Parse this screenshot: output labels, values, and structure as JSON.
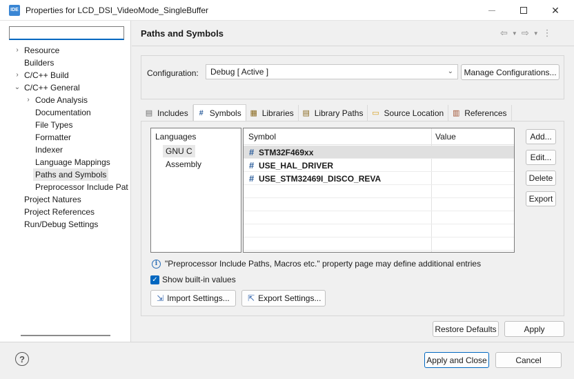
{
  "window": {
    "app_icon": "IDE",
    "title": "Properties for LCD_DSI_VideoMode_SingleBuffer",
    "minimize_icon": "minimize-icon",
    "maximize_icon": "maximize-icon",
    "close_glyph": "✕"
  },
  "sidebar": {
    "filter_value": "",
    "items": [
      {
        "label": "Resource",
        "expander": "›"
      },
      {
        "label": "Builders"
      },
      {
        "label": "C/C++ Build",
        "expander": "›"
      },
      {
        "label": "C/C++ General",
        "expander": "⌄"
      },
      {
        "label": "Code Analysis",
        "expander": "›"
      },
      {
        "label": "Documentation"
      },
      {
        "label": "File Types"
      },
      {
        "label": "Formatter"
      },
      {
        "label": "Indexer"
      },
      {
        "label": "Language Mappings"
      },
      {
        "label": "Paths and Symbols"
      },
      {
        "label": "Preprocessor Include Pat"
      },
      {
        "label": "Project Natures"
      },
      {
        "label": "Project References"
      },
      {
        "label": "Run/Debug Settings"
      }
    ]
  },
  "page": {
    "title": "Paths and Symbols",
    "nav": {
      "back": "⇦",
      "forward": "⇨",
      "dropdown": "▼",
      "menu": "⋮"
    }
  },
  "configuration": {
    "label": "Configuration:",
    "selected": "Debug  [ Active ]",
    "dropdown_glyph": "⌄",
    "manage_label": "Manage Configurations..."
  },
  "tabs": [
    {
      "label": "Includes",
      "icon": "includes-icon",
      "glyph": "▤"
    },
    {
      "label": "Symbols",
      "icon": "hash-icon",
      "glyph": "#"
    },
    {
      "label": "Libraries",
      "icon": "libraries-icon",
      "glyph": "▦"
    },
    {
      "label": "Library Paths",
      "icon": "library-paths-icon",
      "glyph": "▤"
    },
    {
      "label": "Source Location",
      "icon": "folder-icon",
      "glyph": "▭"
    },
    {
      "label": "References",
      "icon": "references-icon",
      "glyph": "▥"
    }
  ],
  "languages": {
    "header": "Languages",
    "items": [
      "GNU C",
      "Assembly"
    ]
  },
  "symbols": {
    "col_symbol": "Symbol",
    "col_value": "Value",
    "hash_glyph": "#",
    "rows": [
      {
        "name": "STM32F469xx",
        "value": ""
      },
      {
        "name": "USE_HAL_DRIVER",
        "value": ""
      },
      {
        "name": "USE_STM32469I_DISCO_REVA",
        "value": ""
      }
    ]
  },
  "side_buttons": {
    "add": "Add...",
    "edit": "Edit...",
    "delete": "Delete",
    "export": "Export"
  },
  "info": {
    "icon_glyph": "i",
    "text": "\"Preprocessor Include Paths, Macros etc.\" property page may define additional entries"
  },
  "show_builtin": {
    "label": "Show built-in values",
    "checked": true,
    "glyph": "✓"
  },
  "import_settings": "Import Settings...",
  "export_settings": "Export Settings...",
  "restore_defaults": "Restore Defaults",
  "apply": "Apply",
  "apply_and_close": "Apply and Close",
  "cancel": "Cancel",
  "help_glyph": "?",
  "colors": {
    "accent": "#0067c0",
    "selection": "#e8e8e8",
    "hash_blue": "#2a5c9a"
  }
}
